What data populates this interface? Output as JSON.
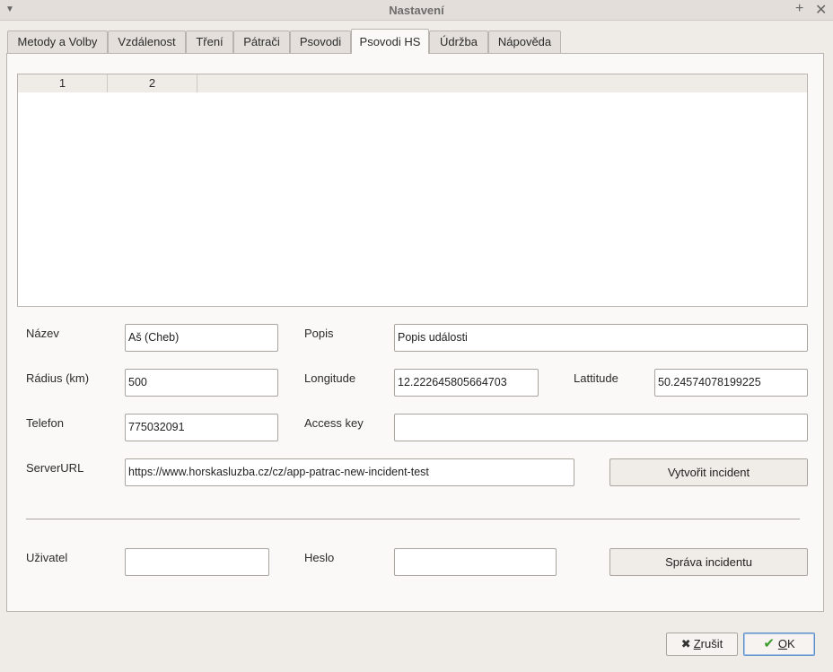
{
  "window": {
    "title": "Nastavení"
  },
  "tabs": [
    {
      "label": "Metody a Volby"
    },
    {
      "label": "Vzdálenost"
    },
    {
      "label": "Tření"
    },
    {
      "label": "Pátrači"
    },
    {
      "label": "Psovodi"
    },
    {
      "label": "Psovodi HS",
      "active": true
    },
    {
      "label": "Údržba"
    },
    {
      "label": "Nápověda"
    }
  ],
  "table": {
    "columns": [
      "1",
      "2"
    ],
    "rows": []
  },
  "form": {
    "nazev": {
      "label": "Název",
      "value": "Aš (Cheb)"
    },
    "popis": {
      "label": "Popis",
      "value": "Popis události"
    },
    "radius": {
      "label": "Rádius (km)",
      "value": "500"
    },
    "longitude": {
      "label": "Longitude",
      "value": "12.222645805664703"
    },
    "lattitude": {
      "label": "Lattitude",
      "value": "50.24574078199225"
    },
    "telefon": {
      "label": "Telefon",
      "value": "775032091"
    },
    "access_key": {
      "label": "Access key",
      "value": ""
    },
    "server_url": {
      "label": "ServerURL",
      "value": "https://www.horskasluzba.cz/cz/app-patrac-new-incident-test"
    },
    "create_incident_label": "Vytvořit incident",
    "uzivatel": {
      "label": "Uživatel",
      "value": ""
    },
    "heslo": {
      "label": "Heslo",
      "value": ""
    },
    "manage_incident_label": "Správa incidentu"
  },
  "footer": {
    "cancel_mnemonic": "Z",
    "cancel_rest": "rušit",
    "ok_mnemonic": "O",
    "ok_rest": "K"
  }
}
